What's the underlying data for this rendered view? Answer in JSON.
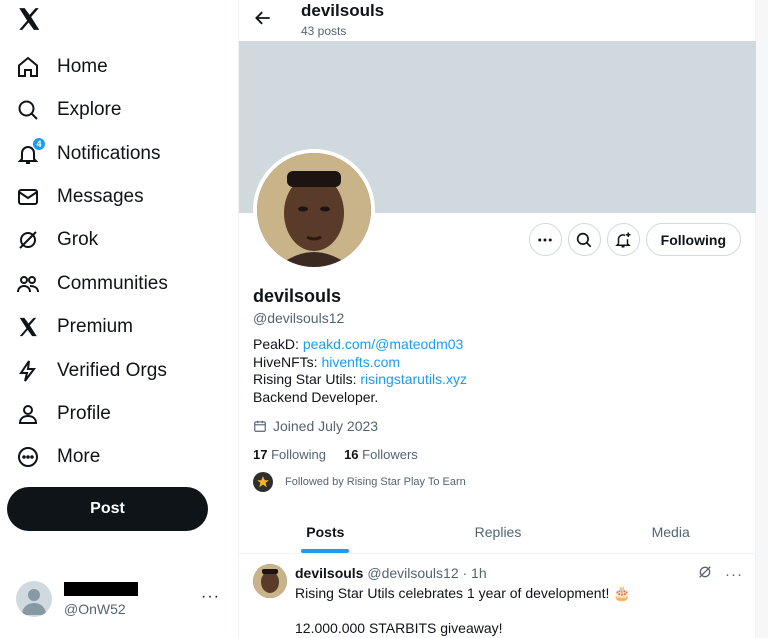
{
  "sidebar": {
    "logo_icon": "x-logo-icon",
    "items": [
      {
        "label": "Home",
        "icon": "home-icon"
      },
      {
        "label": "Explore",
        "icon": "search-icon"
      },
      {
        "label": "Notifications",
        "icon": "bell-icon",
        "badge": "4"
      },
      {
        "label": "Messages",
        "icon": "envelope-icon"
      },
      {
        "label": "Grok",
        "icon": "grok-icon"
      },
      {
        "label": "Communities",
        "icon": "people-icon"
      },
      {
        "label": "Premium",
        "icon": "x-logo-icon"
      },
      {
        "label": "Verified Orgs",
        "icon": "lightning-icon"
      },
      {
        "label": "Profile",
        "icon": "person-icon"
      },
      {
        "label": "More",
        "icon": "more-circle-icon"
      }
    ],
    "post_label": "Post",
    "account": {
      "handle": "@OnW52",
      "more": "···"
    }
  },
  "header": {
    "name": "devilsouls",
    "post_count": "43 posts"
  },
  "profile": {
    "name": "devilsouls",
    "handle": "@devilsouls12",
    "follow_button": "Following",
    "bio": [
      {
        "prefix": "PeakD: ",
        "link": "peakd.com/@mateodm03"
      },
      {
        "prefix": "HiveNFTs: ",
        "link": "hivenfts.com"
      },
      {
        "prefix": "Rising Star Utils: ",
        "link": "risingstarutils.xyz"
      },
      {
        "prefix": "Backend Developer.",
        "link": ""
      }
    ],
    "joined": "Joined July 2023",
    "following_count": "17",
    "following_label": "Following",
    "followers_count": "16",
    "followers_label": "Followers",
    "followed_by": "Followed by Rising Star Play To Earn"
  },
  "tabs": [
    {
      "label": "Posts",
      "active": true
    },
    {
      "label": "Replies",
      "active": false
    },
    {
      "label": "Media",
      "active": false
    }
  ],
  "tweet": {
    "name": "devilsouls",
    "meta": " @devilsouls12 · 1h",
    "text": "Rising Star Utils celebrates 1 year of development! 🎂",
    "text2": "12.000.000 STARBITS giveaway!"
  },
  "colors": {
    "accent": "#1d9bf0",
    "banner": "#cfd9de",
    "text": "#0f1419",
    "muted": "#536471"
  }
}
